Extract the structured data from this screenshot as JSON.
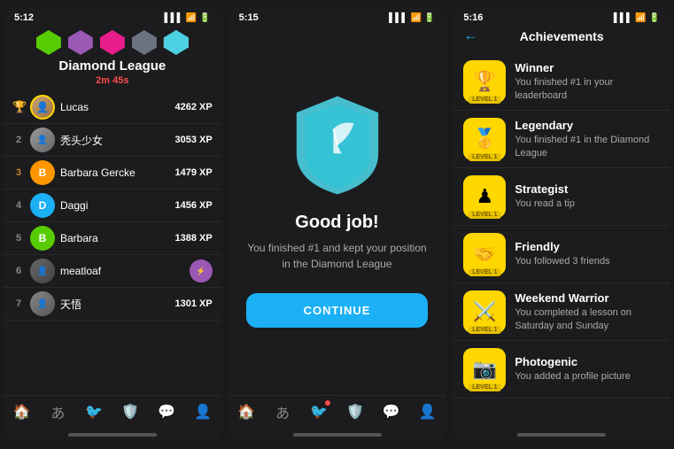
{
  "panel1": {
    "status_time": "5:12",
    "title": "Diamond League",
    "timer": "2m 45s",
    "leaderboard": [
      {
        "rank": "🏆",
        "name": "Lucas",
        "xp": "4262 XP",
        "avatar_type": "photo1",
        "has_ring": true
      },
      {
        "rank": "2",
        "name": "秃头少女",
        "xp": "3053 XP",
        "avatar_type": "photo2",
        "has_ring": false
      },
      {
        "rank": "3",
        "name": "Barbara Gercke",
        "xp": "1479 XP",
        "avatar_type": "letter",
        "letter": "B",
        "bg": "orange-bg",
        "has_ring": false
      },
      {
        "rank": "4",
        "name": "Daggi",
        "xp": "1456 XP",
        "avatar_type": "letter",
        "letter": "D",
        "bg": "blue-bg",
        "has_ring": false
      },
      {
        "rank": "5",
        "name": "Barbara",
        "xp": "1388 XP",
        "avatar_type": "letter",
        "letter": "B",
        "bg": "green-bg",
        "has_ring": false
      },
      {
        "rank": "6",
        "name": "meatloaf",
        "xp": "",
        "avatar_type": "photo3",
        "has_ring": false,
        "has_badge": true
      },
      {
        "rank": "7",
        "name": "天悟",
        "xp": "1301 XP",
        "avatar_type": "photo4",
        "has_ring": false
      }
    ],
    "nav_items": [
      "home",
      "hiragana",
      "character",
      "shield",
      "chat",
      "profile"
    ]
  },
  "panel2": {
    "status_time": "5:15",
    "title": "Good job!",
    "subtitle": "You finished #1 and kept your position in the Diamond League",
    "continue_label": "CONTINUE",
    "nav_items": [
      "home",
      "hiragana",
      "character",
      "shield-active",
      "chat",
      "profile"
    ]
  },
  "panel3": {
    "status_time": "5:16",
    "back_label": "←",
    "title": "Achievements",
    "achievements": [
      {
        "icon": "🏆",
        "level": "LEVEL 1",
        "name": "Winner",
        "desc": "You finished #1 in your leaderboard"
      },
      {
        "icon": "🥇",
        "level": "LEVEL 1",
        "name": "Legendary",
        "desc": "You finished #1 in the Diamond League"
      },
      {
        "icon": "♟",
        "level": "LEVEL 1",
        "name": "Strategist",
        "desc": "You read a tip"
      },
      {
        "icon": "👋",
        "level": "LEVEL 1",
        "name": "Friendly",
        "desc": "You followed 3 friends"
      },
      {
        "icon": "⚔️",
        "level": "LEVEL 1",
        "name": "Weekend Warrior",
        "desc": "You completed a lesson on Saturday and Sunday"
      },
      {
        "icon": "📷",
        "level": "LEVEL 1",
        "name": "Photogenic",
        "desc": "You added a profile picture"
      }
    ]
  }
}
